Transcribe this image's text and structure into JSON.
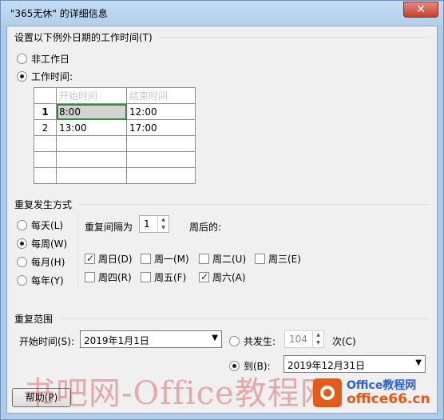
{
  "window": {
    "title": "\"365无休\" 的详细信息",
    "close_glyph": "✕"
  },
  "exception_section": {
    "heading": "设置以下例外日期的工作时间(T)",
    "radio_nonwork": "非工作日",
    "radio_work": "工作时间:",
    "selected": "work"
  },
  "hours_table": {
    "columns": [
      "开始时间",
      "结束时间"
    ],
    "rows": [
      {
        "num": "1",
        "start": "8:00",
        "end": "12:00"
      },
      {
        "num": "2",
        "start": "13:00",
        "end": "17:00"
      },
      {
        "num": "",
        "start": "",
        "end": ""
      },
      {
        "num": "",
        "start": "",
        "end": ""
      },
      {
        "num": "",
        "start": "",
        "end": ""
      }
    ]
  },
  "recurrence": {
    "heading": "重复发生方式",
    "options": [
      "每天(L)",
      "每周(W)",
      "每月(H)",
      "每年(Y)"
    ],
    "selected": "每周(W)",
    "interval_label": "重复间隔为",
    "interval_value": "1",
    "interval_suffix": "周后的:",
    "days": [
      {
        "label": "周日(D)",
        "checked": true
      },
      {
        "label": "周一(M)",
        "checked": false
      },
      {
        "label": "周二(U)",
        "checked": false
      },
      {
        "label": "周三(E)",
        "checked": false
      },
      {
        "label": "周四(R)",
        "checked": false
      },
      {
        "label": "周五(F)",
        "checked": false
      },
      {
        "label": "周六(A)",
        "checked": true
      }
    ]
  },
  "range": {
    "heading": "重复范围",
    "start_label": "开始时间(S):",
    "start_value": "2019年1月1日",
    "occur_label": "共发生:",
    "occur_value": "104",
    "occur_suffix": "次(C)",
    "until_label": "到(B):",
    "until_value": "2019年12月31日",
    "selected": "until"
  },
  "buttons": {
    "help": "帮助(P)"
  },
  "watermark": {
    "text": "书吧网-Office教程网",
    "logo_line1": "Office教程网",
    "logo_line2": "office66.cn"
  }
}
